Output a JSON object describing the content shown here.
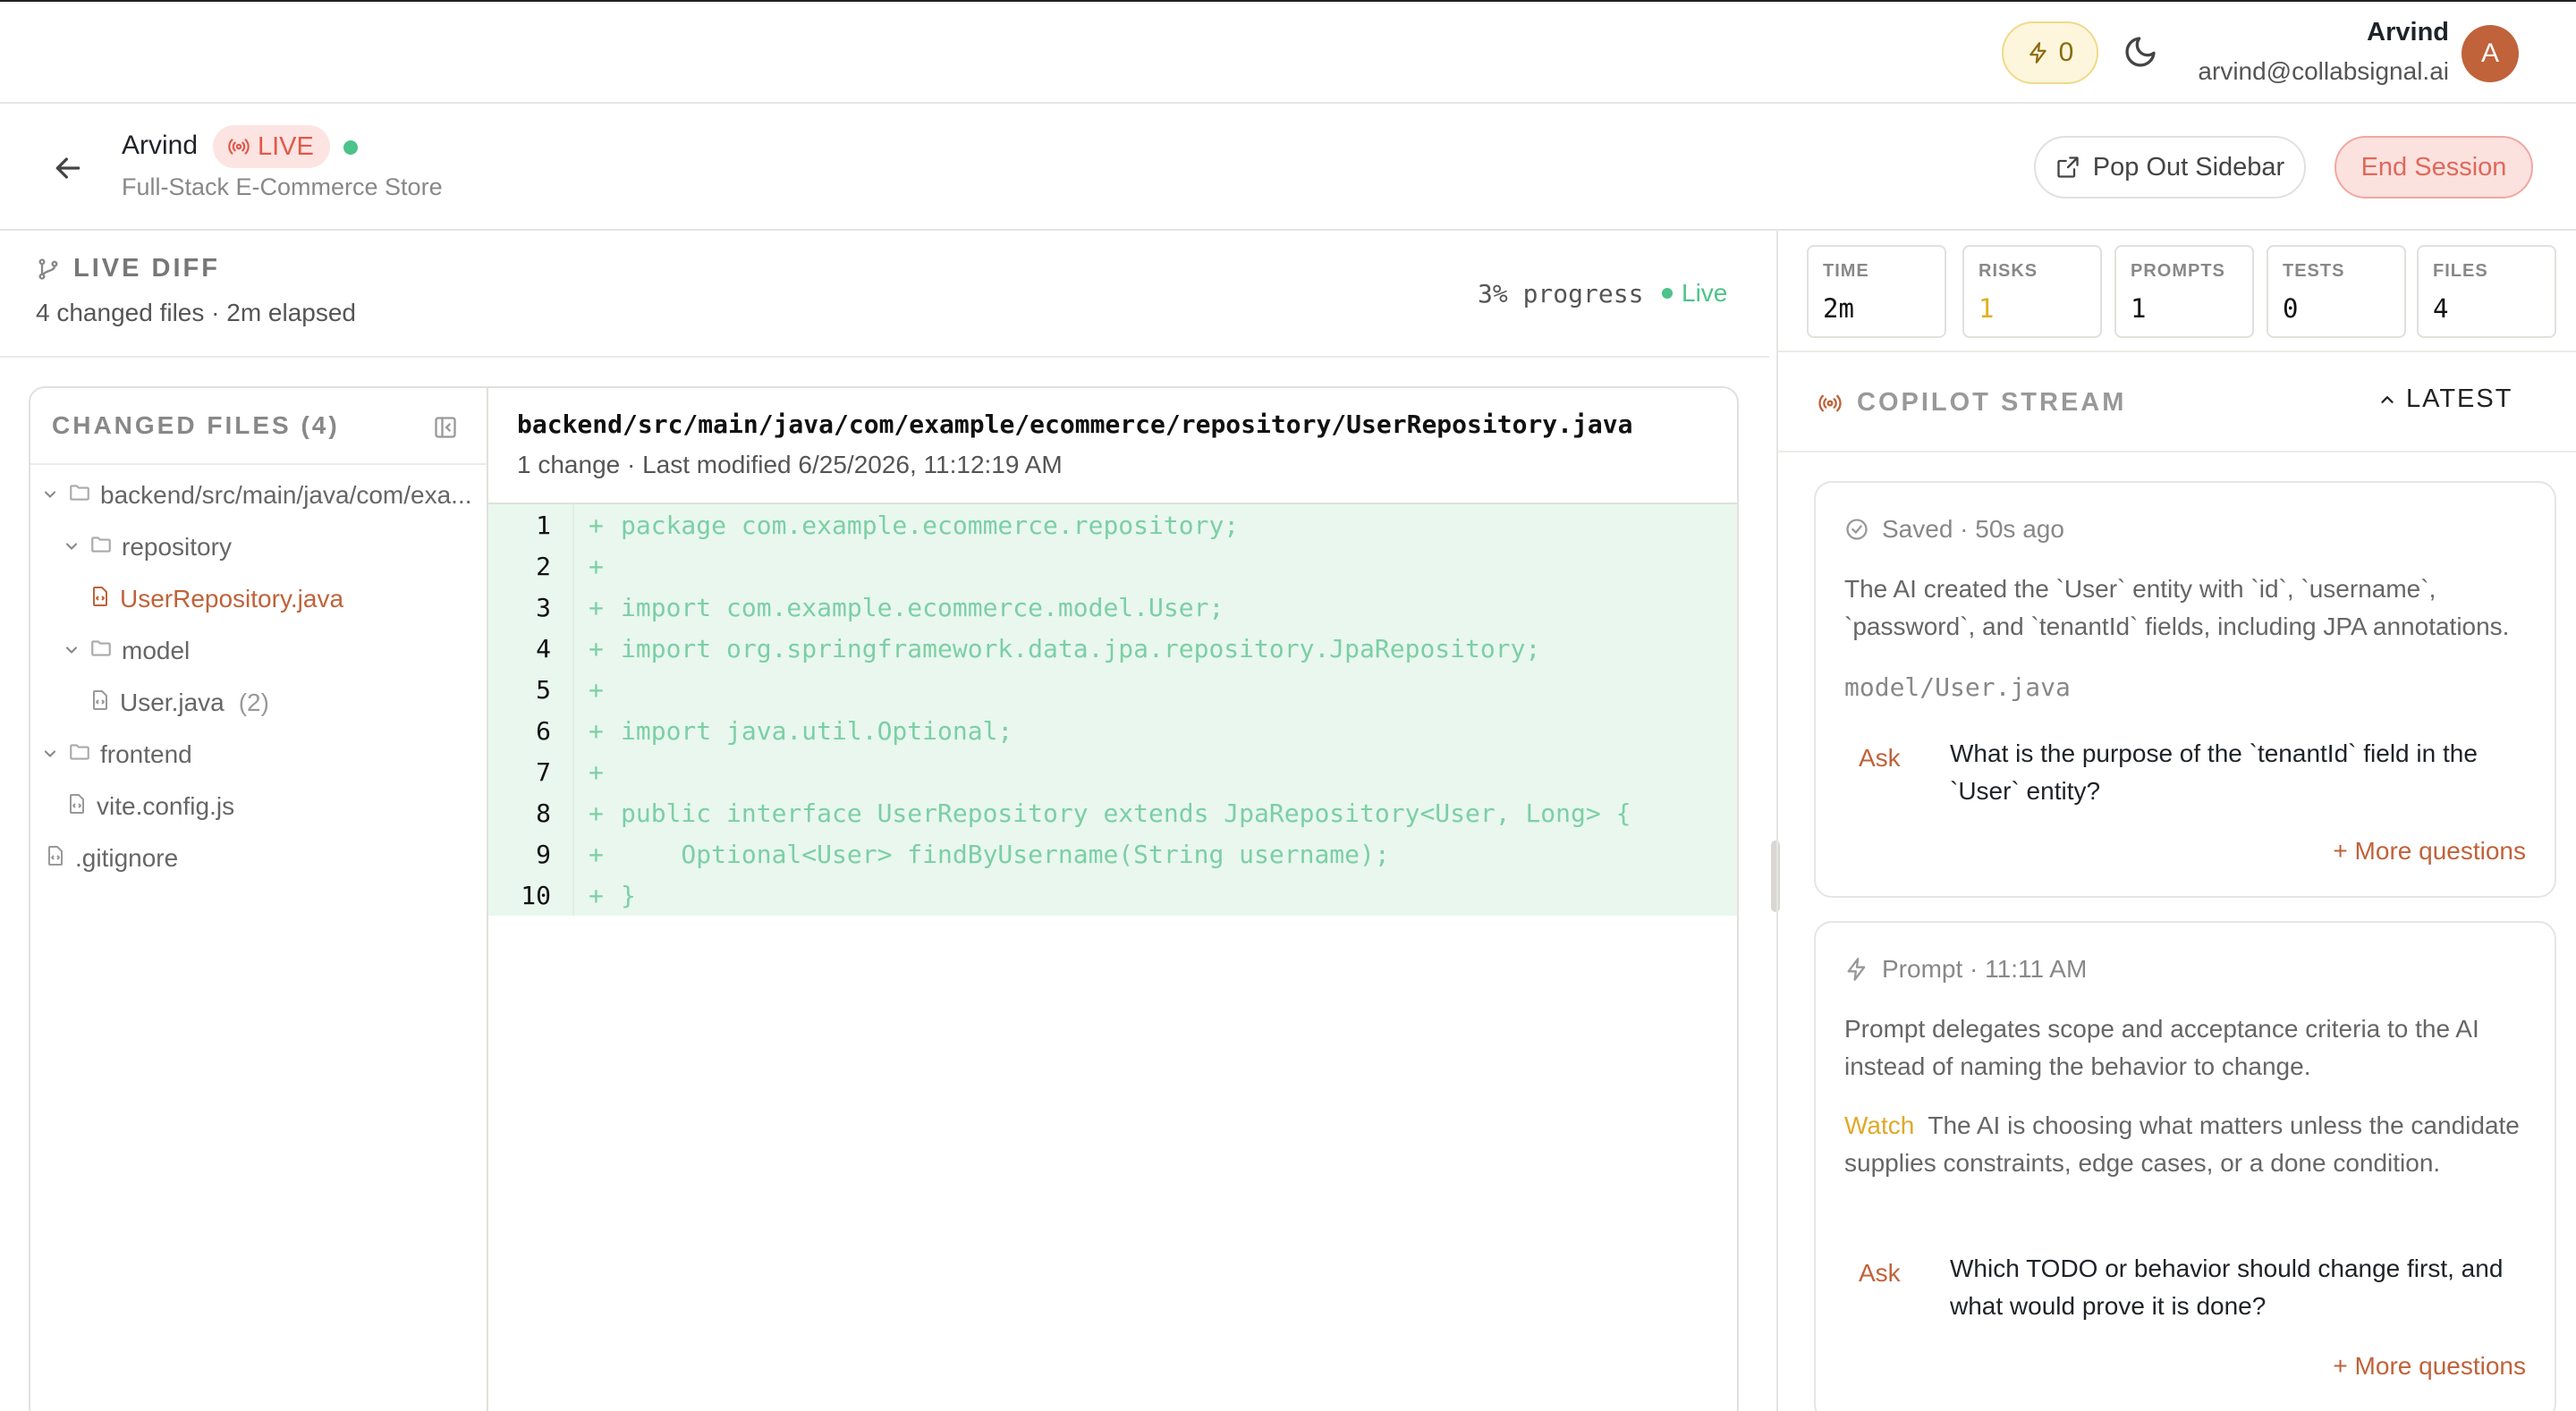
{
  "topbar": {
    "credits": "0",
    "user_name": "Arvind",
    "user_email": "arvind@collabsignal.ai",
    "avatar_initial": "A"
  },
  "session": {
    "name": "Arvind",
    "live_label": "LIVE",
    "project": "Full-Stack E-Commerce Store",
    "popout_label": "Pop Out Sidebar",
    "end_label": "End Session"
  },
  "diff": {
    "title": "LIVE DIFF",
    "subtitle": "4 changed files · 2m elapsed",
    "progress": "3% progress",
    "live": "Live"
  },
  "files": {
    "title": "CHANGED FILES (4)",
    "tree": [
      {
        "label": "backend/src/main/java/com/exa...",
        "type": "folder"
      },
      {
        "label": "repository",
        "type": "folder"
      },
      {
        "label": "UserRepository.java",
        "type": "file",
        "selected": true
      },
      {
        "label": "model",
        "type": "folder"
      },
      {
        "label": "User.java",
        "type": "file",
        "count": "(2)"
      },
      {
        "label": "frontend",
        "type": "folder"
      },
      {
        "label": "vite.config.js",
        "type": "file"
      },
      {
        "label": ".gitignore",
        "type": "file"
      }
    ]
  },
  "code": {
    "path": "backend/src/main/java/com/example/ecommerce/repository/UserRepository.java",
    "meta": "1 change · Last modified 6/25/2026, 11:12:19 AM",
    "lines": [
      {
        "n": "1",
        "text": "package com.example.ecommerce.repository;"
      },
      {
        "n": "2",
        "text": ""
      },
      {
        "n": "3",
        "text": "import com.example.ecommerce.model.User;"
      },
      {
        "n": "4",
        "text": "import org.springframework.data.jpa.repository.JpaRepository;"
      },
      {
        "n": "5",
        "text": ""
      },
      {
        "n": "6",
        "text": "import java.util.Optional;"
      },
      {
        "n": "7",
        "text": ""
      },
      {
        "n": "8",
        "text": "public interface UserRepository extends JpaRepository<User, Long> {"
      },
      {
        "n": "9",
        "text": "    Optional<User> findByUsername(String username);"
      },
      {
        "n": "10",
        "text": "}"
      }
    ]
  },
  "stats": [
    {
      "label": "TIME",
      "value": "2m"
    },
    {
      "label": "RISKS",
      "value": "1",
      "color": "#e0b020"
    },
    {
      "label": "PROMPTS",
      "value": "1"
    },
    {
      "label": "TESTS",
      "value": "0"
    },
    {
      "label": "FILES",
      "value": "4"
    }
  ],
  "stream": {
    "title": "COPILOT STREAM",
    "latest_label": "LATEST",
    "cards": [
      {
        "head": "Saved · 50s ago",
        "text": "The AI created the `User` entity with `id`, `username`, `password`, and `tenantId` fields, including JPA annotations.",
        "file": "model/User.java",
        "ask_label": "Ask",
        "ask_text": "What is the purpose of the `tenantId` field in the `User` entity?",
        "more": "+ More questions"
      },
      {
        "head": "Prompt · 11:11 AM",
        "text": "Prompt delegates scope and acceptance criteria to the AI instead of naming the behavior to change.",
        "watch_label": "Watch",
        "watch_text": "The AI is choosing what matters unless the candidate supplies constraints, edge cases, or a done condition.",
        "ask_label": "Ask",
        "ask_text": "Which TODO or behavior should change first, and what would prove it is done?",
        "more": "+ More questions"
      }
    ]
  }
}
